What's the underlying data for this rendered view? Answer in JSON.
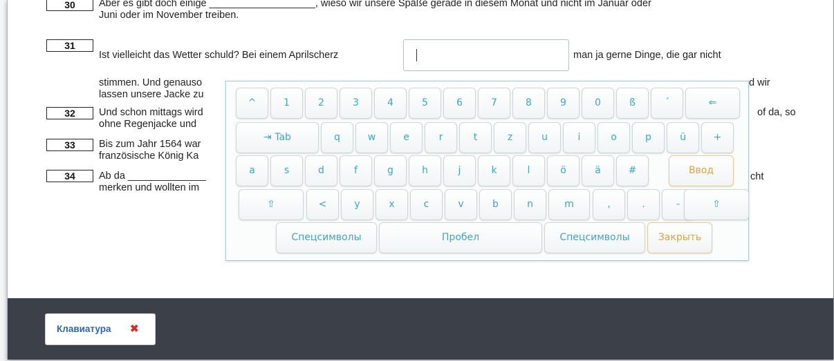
{
  "questions": [
    {
      "num": "30",
      "lines": [
        "Aber es gibt doch einige ___________________, wieso wir unsere Späße gerade in diesem Monat und nicht im Januar oder",
        "Juni oder im November treiben."
      ]
    },
    {
      "num": "31",
      "line_a": "Ist vielleicht das Wetter schuld? Bei einem Aprilscherz",
      "line_b": "man ja gerne Dinge, die gar nicht",
      "cont": [
        "stimmen. Und genauso",
        "d wir",
        "lassen unsere Jacke zu"
      ]
    },
    {
      "num": "32",
      "lines": [
        "Und schon mittags wird",
        "ohne Regenjacke und"
      ],
      "tail": "of da, so"
    },
    {
      "num": "33",
      "lines": [
        "Bis zum Jahr 1564 war",
        "französische König Ka"
      ]
    },
    {
      "num": "34",
      "lines": [
        "Ab da ______________",
        "merken und wollten im"
      ],
      "tail": "cht"
    }
  ],
  "answer_input": {
    "value": ""
  },
  "keyboard": {
    "row1": [
      "^",
      "1",
      "2",
      "3",
      "4",
      "5",
      "6",
      "7",
      "8",
      "9",
      "0",
      "ß",
      "´",
      "⇐"
    ],
    "row2": [
      "⇥ Tab",
      "q",
      "w",
      "e",
      "r",
      "t",
      "z",
      "u",
      "i",
      "o",
      "p",
      "ü",
      "+"
    ],
    "row3": [
      "a",
      "s",
      "d",
      "f",
      "g",
      "h",
      "j",
      "k",
      "l",
      "ö",
      "ä",
      "#",
      "Ввод"
    ],
    "row4": [
      "⇧",
      "<",
      "y",
      "x",
      "c",
      "v",
      "b",
      "n",
      "m",
      ",",
      ".",
      "-",
      "⇧"
    ],
    "row5": [
      "Спецсимволы",
      "Пробел",
      "Спецсимволы",
      "Закрыть"
    ]
  },
  "footer": {
    "keyboard_toggle_label": "Клавиатура",
    "close_glyph": "✖"
  },
  "colors": {
    "key_text": "#3aa8c0",
    "accent_orange": "#e0a43a",
    "footer_bg": "#3b4049",
    "close_red": "#d62c2c"
  }
}
